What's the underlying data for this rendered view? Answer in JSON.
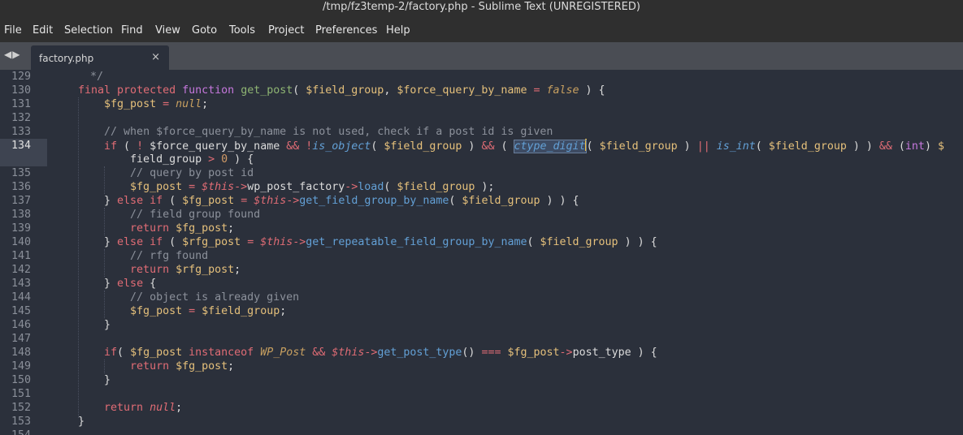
{
  "window": {
    "title": "/tmp/fz3temp-2/factory.php - Sublime Text (UNREGISTERED)"
  },
  "menu": [
    "File",
    "Edit",
    "Selection",
    "Find",
    "View",
    "Goto",
    "Tools",
    "Project",
    "Preferences",
    "Help"
  ],
  "tabs": [
    {
      "label": "factory.php",
      "close": "×"
    }
  ],
  "nav": {
    "back": "◀",
    "forward": "▶"
  },
  "editor": {
    "line_numbers": [
      "129",
      "130",
      "131",
      "132",
      "133",
      "134",
      "135",
      "136",
      "137",
      "138",
      "139",
      "140",
      "141",
      "142",
      "143",
      "144",
      "145",
      "146",
      "147",
      "148",
      "149",
      "150",
      "151",
      "152",
      "153",
      "154"
    ],
    "active_line": "134"
  }
}
